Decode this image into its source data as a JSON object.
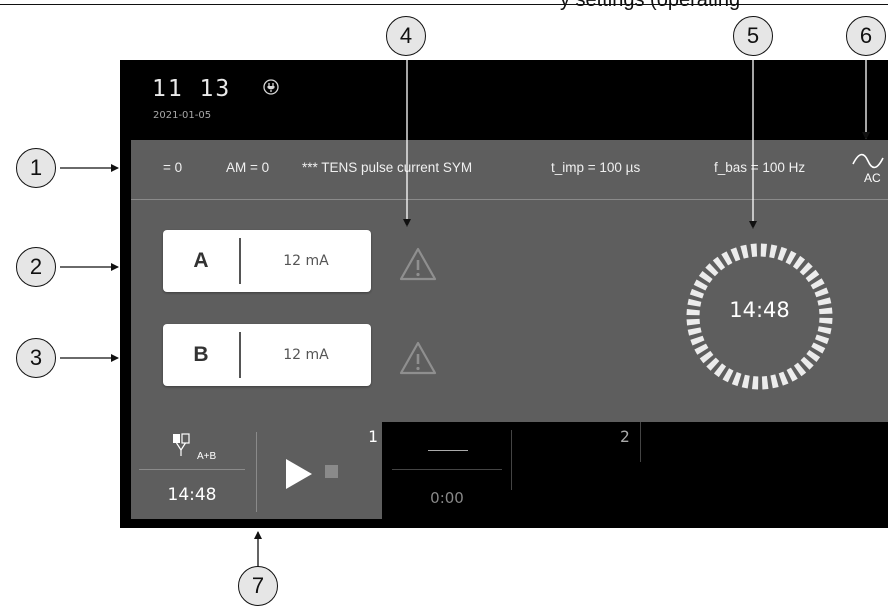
{
  "top_caption_fragment": "y settings (operating",
  "device": {
    "clock": "11 13",
    "date": "2021-01-05",
    "params": {
      "p1": "= 0",
      "p2": "AM = 0",
      "p3": "*** TENS pulse current SYM",
      "p4": "t_imp = 100 µs",
      "p5": "f_bas = 100 Hz"
    },
    "ac_label": "AC",
    "channels": [
      {
        "letter": "A",
        "value": "12 mA"
      },
      {
        "letter": "B",
        "value": "12 mA"
      }
    ],
    "timer": "14:48",
    "program1": {
      "electrode_label": "A+B",
      "time": "14:48",
      "number": "1"
    },
    "program2": {
      "number": "2",
      "time": "0:00"
    }
  },
  "callouts": [
    "1",
    "2",
    "3",
    "4",
    "5",
    "6",
    "7"
  ]
}
